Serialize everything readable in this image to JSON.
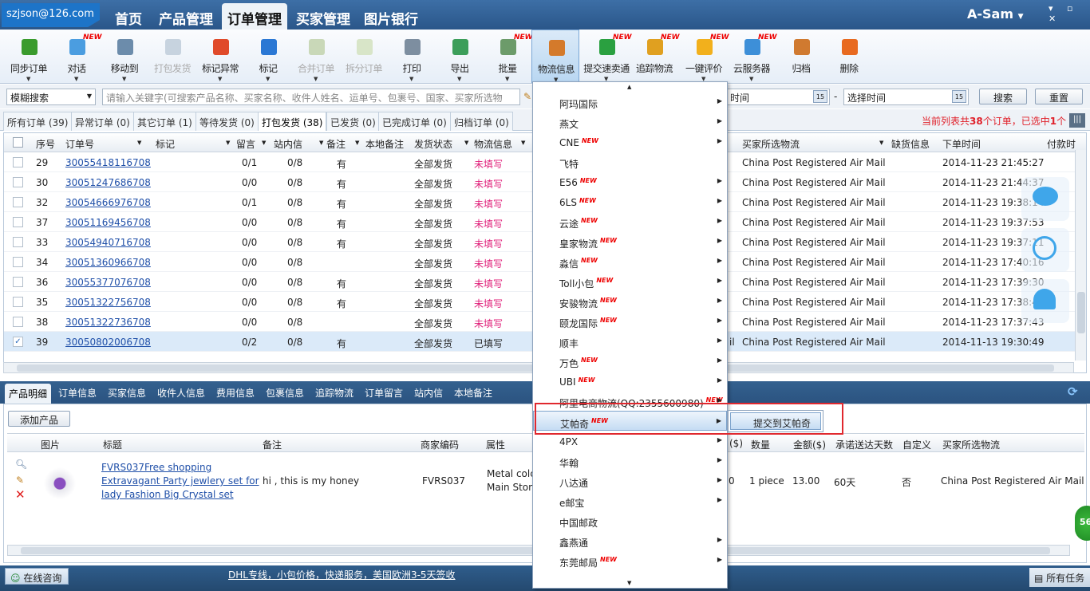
{
  "account": "szjson@126.com",
  "nav": [
    "首页",
    "产品管理",
    "订单管理",
    "买家管理",
    "图片银行"
  ],
  "user": "A-Sam",
  "window_controls": "▾ ▫ ✕",
  "toolbar": [
    {
      "label": "同步订单",
      "icon": "download-arrow-icon",
      "color": "#3a9b2d",
      "dd": true
    },
    {
      "label": "对话",
      "icon": "chat-bubble-icon",
      "color": "#4b9de0",
      "dd": true,
      "new": true
    },
    {
      "label": "移动到",
      "icon": "move-to-icon",
      "color": "#6c8cab",
      "dd": true
    },
    {
      "label": "打包发货",
      "icon": "package-icon",
      "color": "#c7d3df",
      "disabled": true
    },
    {
      "label": "标记异常",
      "icon": "red-flag-icon",
      "color": "#e04a2a",
      "dd": true
    },
    {
      "label": "标记",
      "icon": "blue-flag-icon",
      "color": "#2b78d4",
      "dd": true
    },
    {
      "label": "合并订单",
      "icon": "merge-icon",
      "color": "#c9d8b8",
      "disabled": true,
      "dd": true
    },
    {
      "label": "拆分订单",
      "icon": "split-icon",
      "color": "#d8e5c8",
      "disabled": true
    },
    {
      "label": "打印",
      "icon": "printer-icon",
      "color": "#7d8ea0",
      "dd": true
    },
    {
      "label": "导出",
      "icon": "export-icon",
      "color": "#3c9e5a",
      "dd": true
    },
    {
      "label": "批量",
      "icon": "batch-edit-icon",
      "color": "#6c9b6a",
      "dd": true,
      "new": true
    },
    {
      "label": "物流信息",
      "icon": "logistics-pen-icon",
      "color": "#d47a2b",
      "dd": true,
      "selected": true
    },
    {
      "label": "提交速卖通",
      "icon": "submit-arrow-icon",
      "color": "#2aa040",
      "dd": true,
      "new": true
    },
    {
      "label": "追踪物流",
      "icon": "truck-icon",
      "color": "#e0a020",
      "new": true
    },
    {
      "label": "一键评价",
      "icon": "star-icon",
      "color": "#f2b01c",
      "dd": true,
      "new": true
    },
    {
      "label": "云服务器",
      "icon": "cloud-icon",
      "color": "#3d8fd8",
      "dd": true,
      "new": true
    },
    {
      "label": "归档",
      "icon": "archive-icon",
      "color": "#d07a30"
    },
    {
      "label": "删除",
      "icon": "trash-icon",
      "color": "#e86a20"
    }
  ],
  "new_tag": "NEW",
  "search": {
    "mode": "模糊搜索",
    "placeholder": "请输入关键字(可搜索产品名称、买家名称、收件人姓名、运单号、包裹号、国家、买家所选物",
    "start_time": "时间",
    "end_time": "选择时间",
    "search_btn": "搜索",
    "reset_btn": "重置",
    "dash": "-"
  },
  "filter_tabs": [
    "所有订单 (39)",
    "异常订单 (0)",
    "其它订单 (1)",
    "等待发货 (0)",
    "打包发货 (38)",
    "已发货 (0)",
    "已完成订单 (0)",
    "归档订单 (0)"
  ],
  "summary": {
    "prefix": "当前列表共",
    "count": "38",
    "mid": "个订单，已选中",
    "sel": "1",
    "suffix": "个"
  },
  "columns": [
    "序号",
    "订单号",
    "标记",
    "留言",
    "站内信",
    "备注",
    "本地备注",
    "发货状态",
    "物流信息",
    "买家所选物流",
    "缺货信息",
    "下单时间",
    "付款时"
  ],
  "rows": [
    {
      "seq": "29",
      "order": "30055418116708",
      "msg": "0/1",
      "inbox": "0/8",
      "note": "有",
      "status": "全部发货",
      "logi": "未填写",
      "ship": "China Post Registered Air Mail",
      "time": "2014-11-23 21:45:27"
    },
    {
      "seq": "30",
      "order": "30051247686708",
      "msg": "0/0",
      "inbox": "0/8",
      "note": "有",
      "status": "全部发货",
      "logi": "未填写",
      "ship": "China Post Registered Air Mail",
      "time": "2014-11-23 21:44:37"
    },
    {
      "seq": "32",
      "order": "30054666976708",
      "msg": "0/1",
      "inbox": "0/8",
      "note": "有",
      "status": "全部发货",
      "logi": "未填写",
      "ship": "China Post Registered Air Mail",
      "time": "2014-11-23 19:38:14"
    },
    {
      "seq": "37",
      "order": "30051169456708",
      "msg": "0/0",
      "inbox": "0/8",
      "note": "有",
      "status": "全部发货",
      "logi": "未填写",
      "ship": "China Post Registered Air Mail",
      "time": "2014-11-23 19:37:53"
    },
    {
      "seq": "33",
      "order": "30054940716708",
      "msg": "0/0",
      "inbox": "0/8",
      "note": "有",
      "status": "全部发货",
      "logi": "未填写",
      "ship": "China Post Registered Air Mail",
      "time": "2014-11-23 19:37:11"
    },
    {
      "seq": "34",
      "order": "30051360966708",
      "msg": "0/0",
      "inbox": "0/8",
      "note": "",
      "status": "全部发货",
      "logi": "未填写",
      "ship": "China Post Registered Air Mail",
      "time": "2014-11-23 17:40:16"
    },
    {
      "seq": "36",
      "order": "30055377076708",
      "msg": "0/0",
      "inbox": "0/8",
      "note": "有",
      "status": "全部发货",
      "logi": "未填写",
      "ship": "China Post Registered Air Mail",
      "time": "2014-11-23 17:39:30"
    },
    {
      "seq": "35",
      "order": "30051322756708",
      "msg": "0/0",
      "inbox": "0/8",
      "note": "有",
      "status": "全部发货",
      "logi": "未填写",
      "ship": "China Post Registered Air Mail",
      "time": "2014-11-23 17:38:42"
    },
    {
      "seq": "38",
      "order": "30051322736708",
      "msg": "0/0",
      "inbox": "0/8",
      "note": "",
      "status": "全部发货",
      "logi": "未填写",
      "ship": "China Post Registered Air Mail",
      "time": "2014-11-23 17:37:43"
    },
    {
      "seq": "39",
      "order": "30050802006708",
      "msg": "0/2",
      "inbox": "0/8",
      "note": "有",
      "status": "全部发货",
      "logi": "已填写",
      "ship": "China Post Registered Air Mail",
      "time": "2014-11-13 19:30:49",
      "selected": true,
      "logi_tail": "il"
    }
  ],
  "bottom_tabs": [
    "产品明细",
    "订单信息",
    "买家信息",
    "收件人信息",
    "费用信息",
    "包裹信息",
    "追踪物流",
    "订单留言",
    "站内信",
    "本地备注"
  ],
  "add_product": "添加产品",
  "product_cols": [
    "图片",
    "标题",
    "备注",
    "商家编码",
    "属性",
    "($)",
    "数量",
    "金额($)",
    "承诺送达天数",
    "自定义",
    "买家所选物流"
  ],
  "product": {
    "title1": "FVRS037Free shopping",
    "title2": "Extravagant Party jewlery set for",
    "title3": "lady Fashion Big Crystal set",
    "note": "hi , this is my honey",
    "code": "FVRS037",
    "attr1": "Metal colc",
    "attr2": "Main Ston",
    "price_tail": "0",
    "qty": "1 piece",
    "amount": "13.00",
    "days": "60天",
    "custom": "否",
    "ship": "China Post Registered Air Mail"
  },
  "status": {
    "consult": "在线咨询",
    "ad": "DHL专线，小包价格，快递服务，美国欧洲3-5天签收",
    "tasks": "所有任务",
    "badge": "56"
  },
  "menu": [
    {
      "label": "阿玛国际",
      "sub": true
    },
    {
      "label": "燕文",
      "sub": true
    },
    {
      "label": "CNE",
      "new": true,
      "sub": true
    },
    {
      "label": "飞特"
    },
    {
      "label": "E56",
      "new": true,
      "sub": true
    },
    {
      "label": "6LS",
      "new": true,
      "sub": true
    },
    {
      "label": "云途",
      "new": true,
      "sub": true
    },
    {
      "label": "皇家物流",
      "new": true,
      "sub": true
    },
    {
      "label": "淼信",
      "new": true,
      "sub": true
    },
    {
      "label": "Toll小包",
      "new": true,
      "sub": true
    },
    {
      "label": "安骏物流",
      "new": true,
      "sub": true
    },
    {
      "label": "颐龙国际",
      "new": true,
      "sub": true
    },
    {
      "label": "顺丰",
      "sub": true
    },
    {
      "label": "万色",
      "new": true,
      "sub": true
    },
    {
      "label": "UBI",
      "new": true,
      "sub": true
    },
    {
      "label": "阿里电商物流(QQ:2355600980)",
      "new": true,
      "sub": true
    },
    {
      "label": "艾帕奇",
      "new": true,
      "sub": true,
      "hl": true
    },
    {
      "label": "4PX",
      "sub": true
    },
    {
      "label": "华翰",
      "sub": true
    },
    {
      "label": "八达通",
      "sub": true
    },
    {
      "label": "e邮宝",
      "sub": true
    },
    {
      "label": "中国邮政"
    },
    {
      "label": "鑫燕通",
      "sub": true
    },
    {
      "label": "东莞邮局",
      "new": true,
      "sub": true
    }
  ],
  "submenu_item": "提交到艾帕奇"
}
